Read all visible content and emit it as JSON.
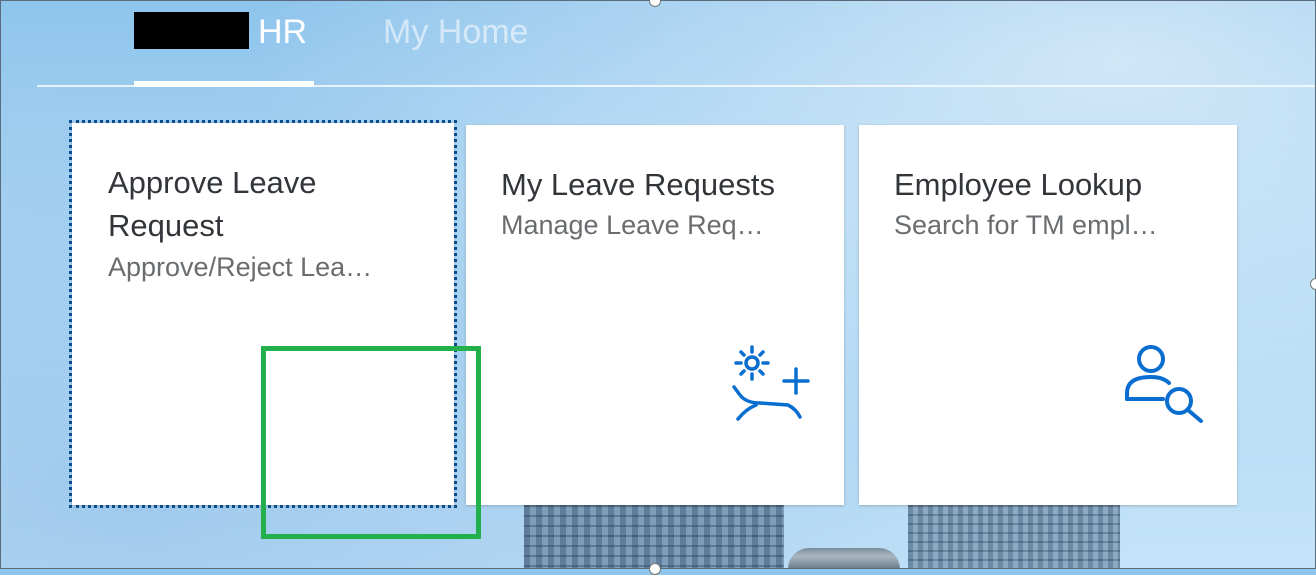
{
  "header": {
    "tabs": [
      {
        "label": "HR",
        "active": true
      },
      {
        "label": "My Home",
        "active": false
      }
    ]
  },
  "tiles": [
    {
      "title": "Approve Leave Request",
      "subtitle": "Approve/Reject Lea…",
      "icon": null,
      "focused": true
    },
    {
      "title": "My Leave Requests",
      "subtitle": "Manage Leave Req…",
      "icon": "leave-request-add-icon"
    },
    {
      "title": "Employee Lookup",
      "subtitle": "Search for TM empl…",
      "icon": "person-search-icon"
    }
  ],
  "colors": {
    "accent": "#0a6ed1",
    "tile_title": "#32363a",
    "tile_subtitle": "#6a6d70",
    "focus_outline": "#0b4c8c",
    "highlight": "#21b04b"
  }
}
